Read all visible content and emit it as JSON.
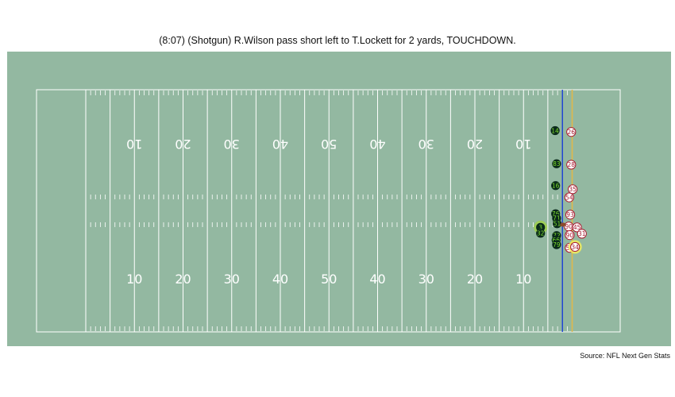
{
  "play": {
    "title": "(8:07) (Shotgun) R.Wilson pass short left to T.Lockett for 2 yards, TOUCHDOWN.",
    "source": "Source: NFL Next Gen Stats"
  },
  "colors": {
    "field_background": "#93b8a1",
    "field_lines": "#ffffff",
    "line_of_scrimmage": "#1a3fd6",
    "first_down_line": "#e0b84a",
    "offense_fill": "#0a2a1a",
    "offense_text": "#7ddc2f",
    "defense_fill": "#ffffff",
    "defense_outline": "#a6192e",
    "defense_text": "#a6192e",
    "highlight_offense": "#9fd04a",
    "highlight_defense": "#f2ef5c",
    "football": "#8b4a2b"
  },
  "yard_numbers": [
    "10",
    "20",
    "30",
    "40",
    "50",
    "40",
    "30",
    "20",
    "10"
  ],
  "markers": {
    "line_of_scrimmage_yardline": 98,
    "first_down_yardline": 100
  },
  "offense": [
    {
      "jersey": "14",
      "yardline": 96.5,
      "field_y": 44.3
    },
    {
      "jersey": "83",
      "yardline": 96.8,
      "field_y": 37.0
    },
    {
      "jersey": "16",
      "yardline": 96.6,
      "field_y": 32.2
    },
    {
      "jersey": "76",
      "yardline": 96.6,
      "field_y": 26.0
    },
    {
      "jersey": "71",
      "yardline": 96.8,
      "field_y": 25.0
    },
    {
      "jersey": "51",
      "yardline": 96.9,
      "field_y": 23.8
    },
    {
      "jersey": "3",
      "yardline": 93.5,
      "field_y": 23.0,
      "highlight": true
    },
    {
      "jersey": "32",
      "yardline": 93.5,
      "field_y": 21.7
    },
    {
      "jersey": "72",
      "yardline": 96.8,
      "field_y": 21.2
    },
    {
      "jersey": "66",
      "yardline": 96.7,
      "field_y": 20.2
    },
    {
      "jersey": "79",
      "yardline": 96.8,
      "field_y": 19.2
    }
  ],
  "defense": [
    {
      "jersey": "26",
      "yardline": 99.8,
      "field_y": 44.0
    },
    {
      "jersey": "28",
      "yardline": 99.8,
      "field_y": 36.8
    },
    {
      "jersey": "35",
      "yardline": 100.1,
      "field_y": 31.4
    },
    {
      "jersey": "54",
      "yardline": 99.4,
      "field_y": 29.6
    },
    {
      "jersey": "93",
      "yardline": 99.6,
      "field_y": 25.8
    },
    {
      "jersey": "90",
      "yardline": 99.3,
      "field_y": 23.2
    },
    {
      "jersey": "45",
      "yardline": 101.0,
      "field_y": 23.0
    },
    {
      "jersey": "90",
      "yardline": 99.5,
      "field_y": 21.3
    },
    {
      "jersey": "31",
      "yardline": 102.0,
      "field_y": 21.6
    },
    {
      "jersey": "58",
      "yardline": 99.5,
      "field_y": 18.5
    },
    {
      "jersey": "34",
      "yardline": 100.6,
      "field_y": 18.7,
      "highlight": true
    }
  ],
  "football": {
    "yardline": 98.1,
    "field_y": 23.6
  }
}
